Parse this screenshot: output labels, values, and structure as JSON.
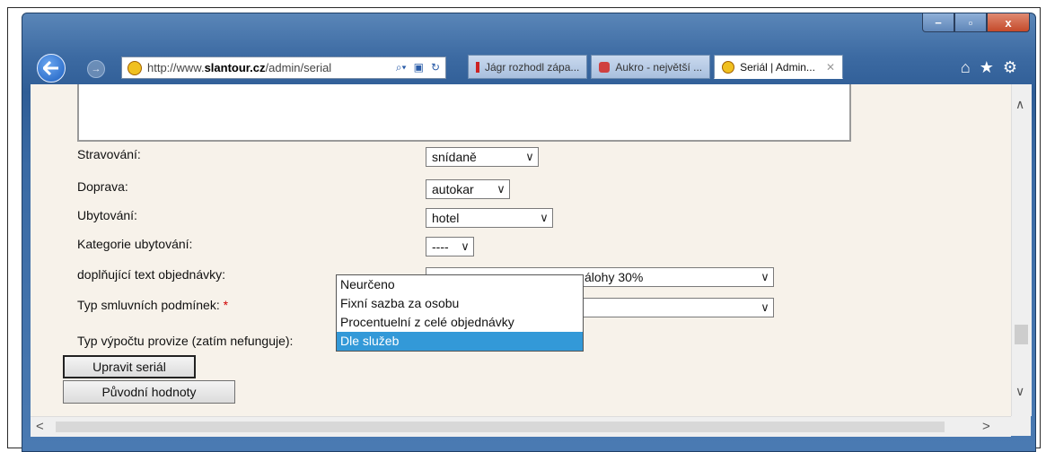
{
  "browser": {
    "address_url": "http://www.slantour.cz/admin/serial",
    "address_url_prefix": "http://www.",
    "address_url_domain": "slantour.cz",
    "address_url_path": "/admin/serial",
    "tabs": [
      {
        "label": "Jágr rozhodl zápa...",
        "active": false,
        "icon_color": "#cc2222"
      },
      {
        "label": "Aukro - největší ...",
        "active": false,
        "icon_color": "#d04040"
      },
      {
        "label": "Seriál | Admin...",
        "active": true,
        "icon_color": "#f0c020"
      }
    ],
    "window_buttons": {
      "minimize": "−",
      "maximize": "▫",
      "close": "x"
    }
  },
  "form": {
    "stravovani_label": "Stravování:",
    "stravovani_value": "snídaně",
    "doprava_label": "Doprava:",
    "doprava_value": "autokar",
    "ubytovani_label": "Ubytování:",
    "ubytovani_value": "hotel",
    "kategorie_label": "Kategorie ubytování:",
    "kategorie_value": "----",
    "doplnujici_label": "doplňující text objednávky:",
    "doplnujici_value_visible": "álohy 30%",
    "typ_smluvnich_label": "Typ smluvních podmínek:",
    "required_marker": "*",
    "typ_smluvnich_value": "",
    "typ_vypoctu_label": "Typ výpočtu provize (zatím nefunguje):",
    "typ_vypoctu_options": [
      "Neurčeno",
      "Fixní sazba za osobu",
      "Procentuelní z celé objednávky",
      "Dle služeb"
    ],
    "typ_vypoctu_selected_index": 3,
    "upravit_button": "Upravit seriál",
    "puvodni_button": "Původní hodnoty"
  },
  "colors": {
    "content_bg": "#f7f2ea",
    "dropdown_highlight": "#3399d8",
    "required": "#d00000"
  }
}
